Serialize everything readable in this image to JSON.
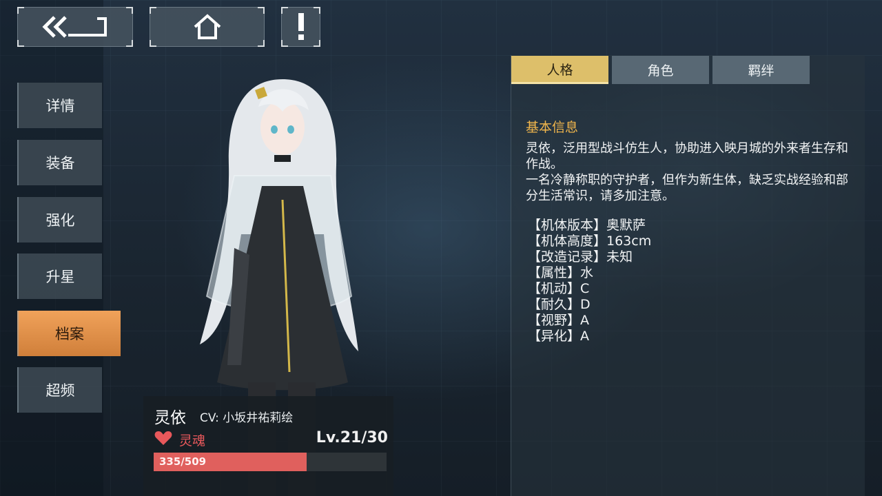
{
  "topbar": {
    "back_icon": "back-arrow-icon",
    "home_icon": "home-icon",
    "info_icon": "exclamation-icon"
  },
  "sidebar": {
    "items": [
      {
        "label": "详情",
        "active": false
      },
      {
        "label": "装备",
        "active": false
      },
      {
        "label": "强化",
        "active": false
      },
      {
        "label": "升星",
        "active": false
      },
      {
        "label": "档案",
        "active": true
      },
      {
        "label": "超频",
        "active": false
      }
    ]
  },
  "character": {
    "name": "灵依",
    "cv": "CV: 小坂井祐莉绘",
    "soul_label": "灵魂",
    "level": "Lv.21/30",
    "hp_text": "335/509",
    "hp_current": 335,
    "hp_max": 509
  },
  "panel": {
    "tabs": [
      {
        "label": "人格",
        "active": true
      },
      {
        "label": "角色",
        "active": false
      },
      {
        "label": "羁绊",
        "active": false
      }
    ],
    "section_title": "基本信息",
    "description": [
      "灵依，泛用型战斗仿生人，协助进入映月城的外来者生存和作战。",
      "一名冷静称职的守护者，但作为新生体，缺乏实战经验和部分生活常识，请多加注意。"
    ],
    "attributes": [
      "【机体版本】奥默萨",
      "【机体高度】163cm",
      "【改造记录】未知",
      "【属性】水",
      "【机动】C",
      "【耐久】D",
      "【视野】A",
      "【异化】A"
    ]
  },
  "colors": {
    "accent_orange": "#e0924a",
    "tab_gold": "#ddbf6a",
    "title_gold": "#f1b64c",
    "soul_red": "#e8585b"
  }
}
